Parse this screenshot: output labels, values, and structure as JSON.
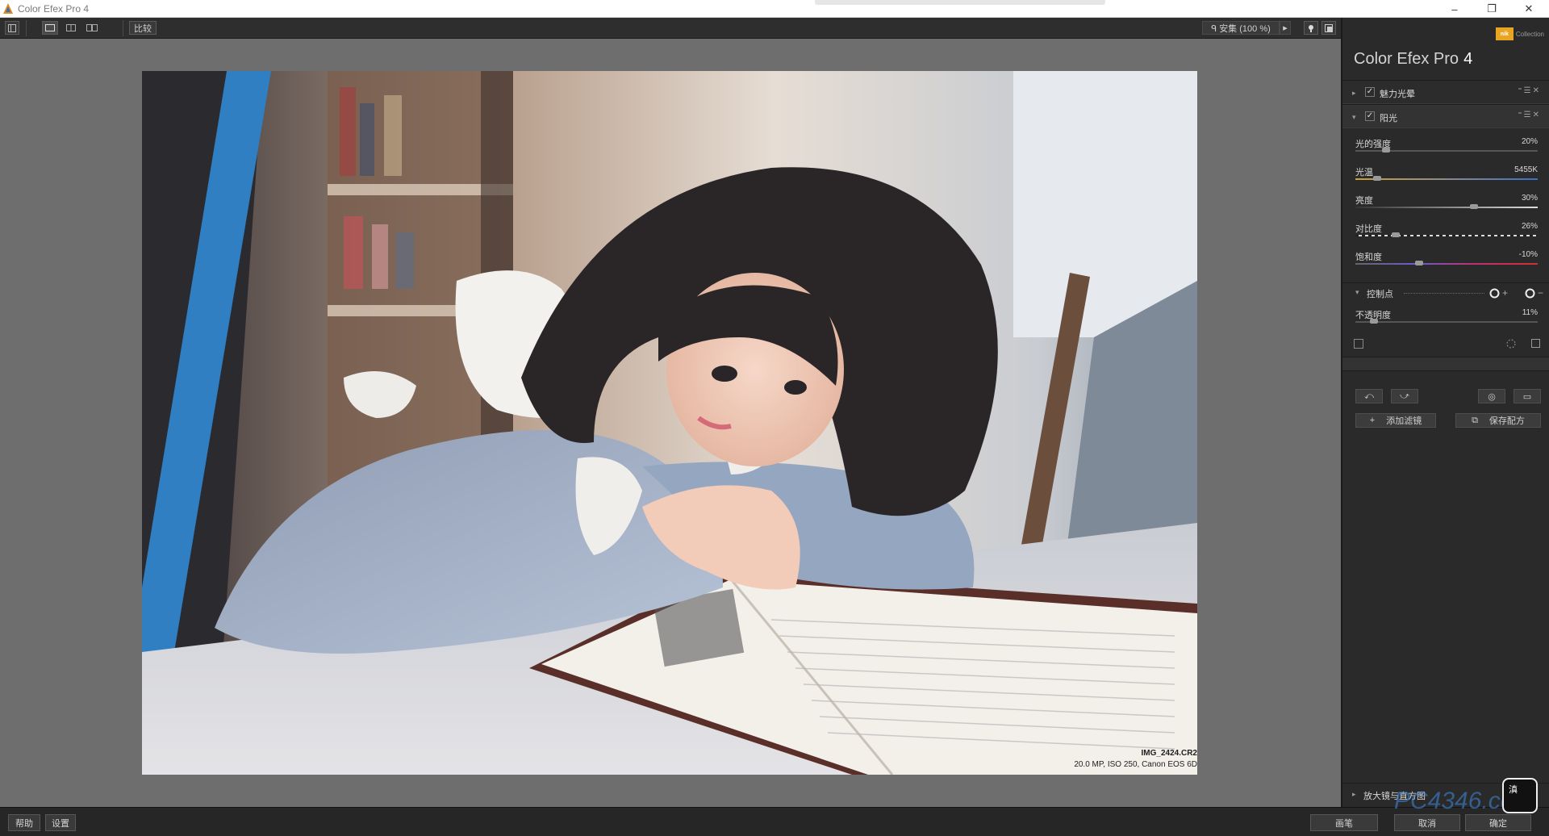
{
  "window": {
    "title": "Color Efex Pro 4",
    "controls": [
      "–",
      "❐",
      "✕"
    ]
  },
  "toolbar": {
    "compare_label": "比较",
    "zoom_label": "ᑫ 安集 (100 %)",
    "zoom_arrow": "▸"
  },
  "image": {
    "filename": "IMG_2424.CR2",
    "details": "20.0 MP, ISO 250, Canon EOS 6D"
  },
  "panel": {
    "logo_text": "nik",
    "logo_sub": "Collection",
    "title": "Color Efex Pro",
    "version": "4",
    "filters": [
      {
        "name": "魅力光晕",
        "checked": "✓",
        "tri": "▸"
      },
      {
        "name": "阳光",
        "checked": "✓",
        "tri": "▾"
      }
    ],
    "filter_controls": "⁼☰✕",
    "sliders": [
      {
        "label": "光的强度",
        "value": "20%",
        "level": 0.17
      },
      {
        "label": "光温",
        "value": "5455K",
        "level": 0.12
      },
      {
        "label": "亮度",
        "value": "30%",
        "level": 0.65
      },
      {
        "label": "对比度",
        "value": "26%",
        "level": 0.22
      },
      {
        "label": "饱和度",
        "value": "-10%",
        "level": 0.35
      }
    ],
    "control_points_label": "控制点",
    "opacity": {
      "label": "不透明度",
      "value": "11%",
      "level": 0.1
    },
    "add_filter_label": "添加滤镜",
    "save_recipe_label": "保存配方",
    "loupe_label": "放大镜与直方图"
  },
  "bottom": {
    "help_label": "帮助",
    "settings_label": "设置",
    "brush_label": "画笔",
    "cancel_label": "取消",
    "ok_label": "确定"
  },
  "watermark": {
    "text": "PC4346.com",
    "badge": "滇"
  }
}
